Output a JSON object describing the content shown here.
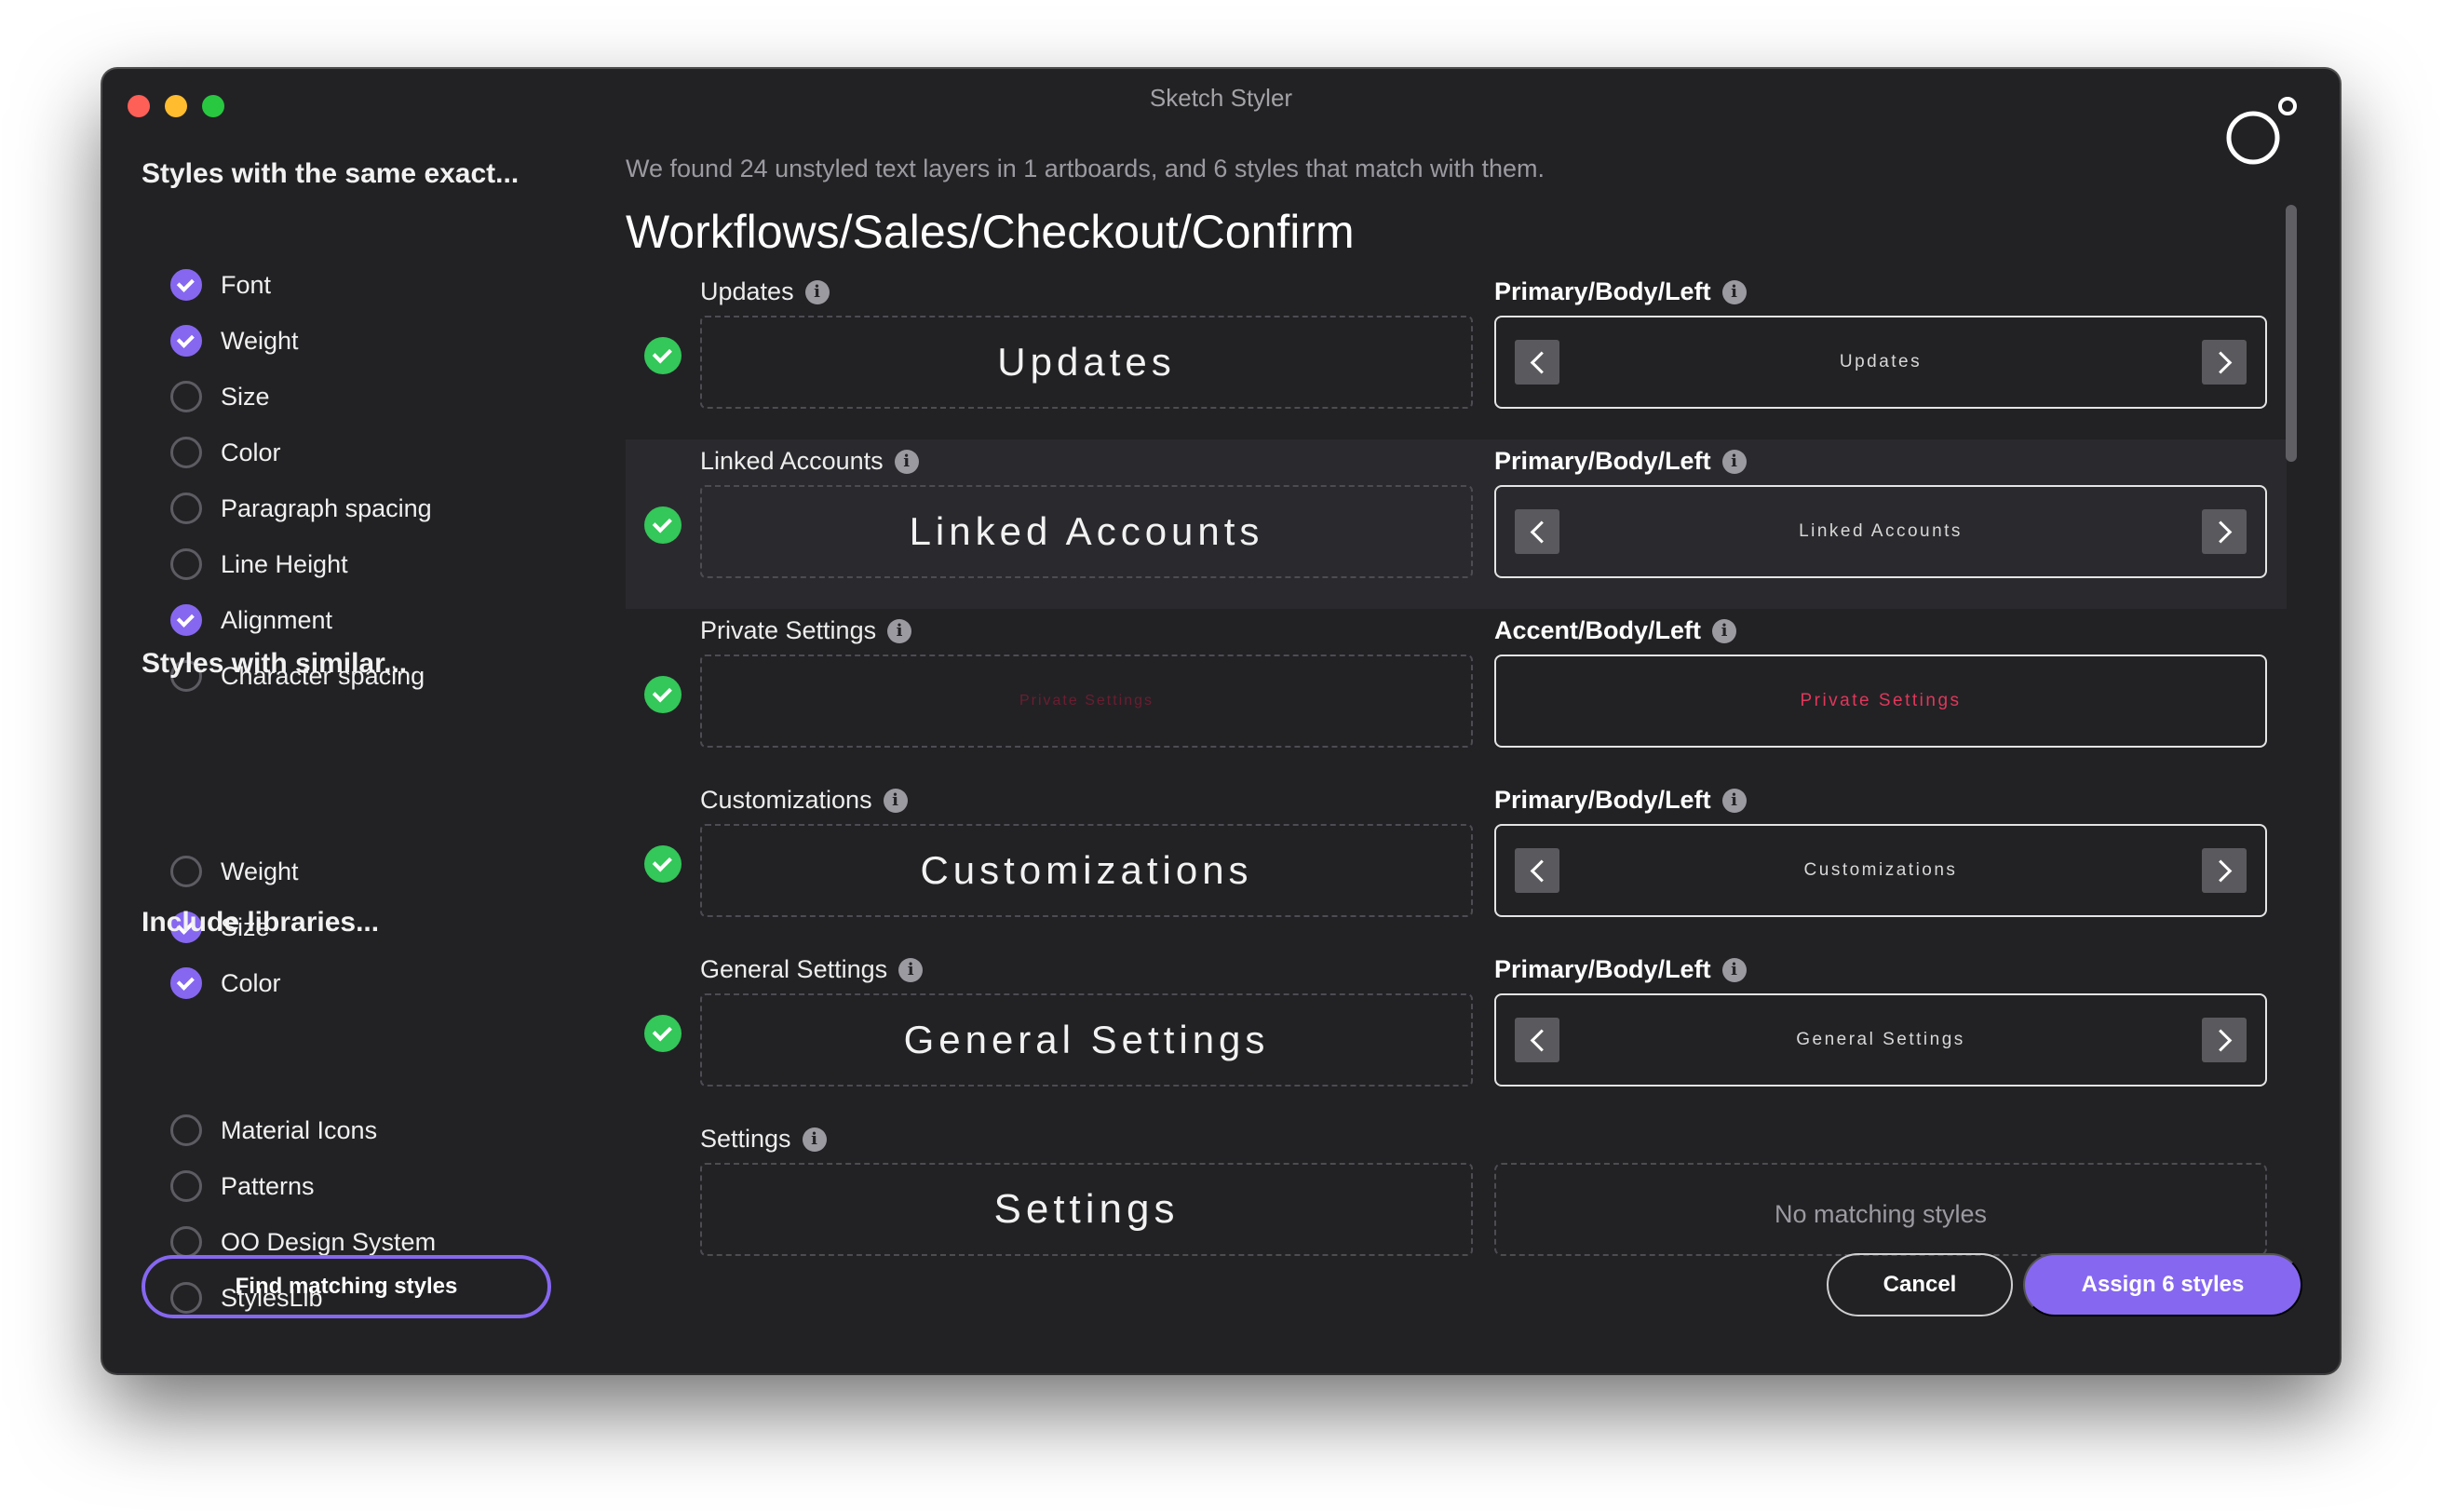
{
  "window": {
    "title": "Sketch Styler"
  },
  "sidebar": {
    "exact": {
      "title": "Styles with the same exact...",
      "options": [
        {
          "label": "Font",
          "checked": true
        },
        {
          "label": "Weight",
          "checked": true
        },
        {
          "label": "Size",
          "checked": false
        },
        {
          "label": "Color",
          "checked": false
        },
        {
          "label": "Paragraph spacing",
          "checked": false
        },
        {
          "label": "Line Height",
          "checked": false
        },
        {
          "label": "Alignment",
          "checked": true
        },
        {
          "label": "Character spacing",
          "checked": false
        }
      ]
    },
    "similar": {
      "title": "Styles with similar...",
      "options": [
        {
          "label": "Weight",
          "checked": false
        },
        {
          "label": "Size",
          "checked": true
        },
        {
          "label": "Color",
          "checked": true
        }
      ]
    },
    "libraries": {
      "title": "Include libraries...",
      "options": [
        {
          "label": "Material Icons",
          "checked": false
        },
        {
          "label": "Patterns",
          "checked": false
        },
        {
          "label": "OO Design System",
          "checked": false
        },
        {
          "label": "StylesLib",
          "checked": false
        }
      ]
    },
    "find_button": "Find matching styles"
  },
  "main": {
    "summary": "We found 24 unstyled text layers in 1 artboards, and 6 styles that match with them.",
    "heading": "Workflows/Sales/Checkout/Confirm",
    "rows": [
      {
        "layer": "Updates",
        "preview": "Updates",
        "matched": true,
        "style": "Primary/Body/Left",
        "sample": "Updates",
        "has_nav": true,
        "highlight": false,
        "preview_color": "#f2f2f2",
        "sample_color": "#d8d8d8"
      },
      {
        "layer": "Linked Accounts",
        "preview": "Linked Accounts",
        "matched": true,
        "style": "Primary/Body/Left",
        "sample": "Linked Accounts",
        "has_nav": true,
        "highlight": true,
        "preview_color": "#f2f2f2",
        "sample_color": "#d8d8d8"
      },
      {
        "layer": "Private Settings",
        "preview": "Private Settings",
        "matched": true,
        "style": "Accent/Body/Left",
        "sample": "Private Settings",
        "has_nav": false,
        "highlight": false,
        "preview_color": "#6b1e30",
        "sample_color": "#e0375a"
      },
      {
        "layer": "Customizations",
        "preview": "Customizations",
        "matched": true,
        "style": "Primary/Body/Left",
        "sample": "Customizations",
        "has_nav": true,
        "highlight": false,
        "preview_color": "#f2f2f2",
        "sample_color": "#d8d8d8"
      },
      {
        "layer": "General Settings",
        "preview": "General Settings",
        "matched": true,
        "style": "Primary/Body/Left",
        "sample": "General Settings",
        "has_nav": true,
        "highlight": false,
        "preview_color": "#f2f2f2",
        "sample_color": "#d8d8d8"
      },
      {
        "layer": "Settings",
        "preview": "Settings",
        "matched": false,
        "style": "",
        "sample": "No matching styles",
        "has_nav": false,
        "highlight": false,
        "preview_color": "#f2f2f2",
        "sample_color": "#9a9aa0"
      }
    ],
    "info_glyph": "i"
  },
  "footer": {
    "cancel": "Cancel",
    "assign": "Assign 6 styles"
  },
  "colors": {
    "accent": "#8667f0",
    "success": "#34c759",
    "accent_red": "#e0375a"
  },
  "icons": {
    "logo": "circle-logo-icon",
    "check": "check-icon",
    "info": "info-icon",
    "prev": "chevron-left-icon",
    "next": "chevron-right-icon"
  }
}
